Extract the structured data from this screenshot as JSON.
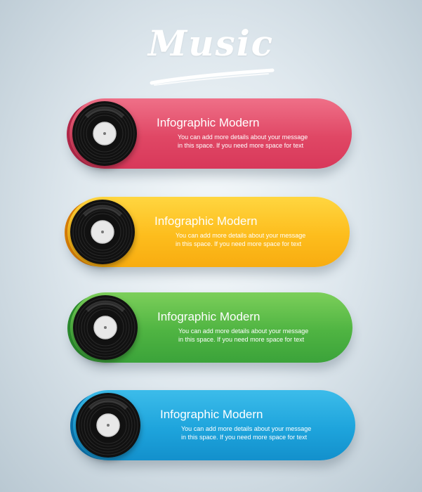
{
  "header": {
    "title": "Music"
  },
  "items": [
    {
      "title": "Infographic Modern",
      "line1": "You can add more details about your message",
      "line2": "in this space. If you need more space for text",
      "color": "#e04765"
    },
    {
      "title": "Infographic Modern",
      "line1": "You can add more details about your message",
      "line2": "in this space. If you need more space for text",
      "color": "#fdbd1d"
    },
    {
      "title": "Infographic Modern",
      "line1": "You can add more details about your message",
      "line2": "in this space. If you need more space for text",
      "color": "#4fb442"
    },
    {
      "title": "Infographic Modern",
      "line1": "You can add more details about your message",
      "line2": "in this space. If you need more space for text",
      "color": "#1ea4dc"
    }
  ],
  "icons": {
    "record": "vinyl-record-icon",
    "underline": "brush-stroke"
  }
}
